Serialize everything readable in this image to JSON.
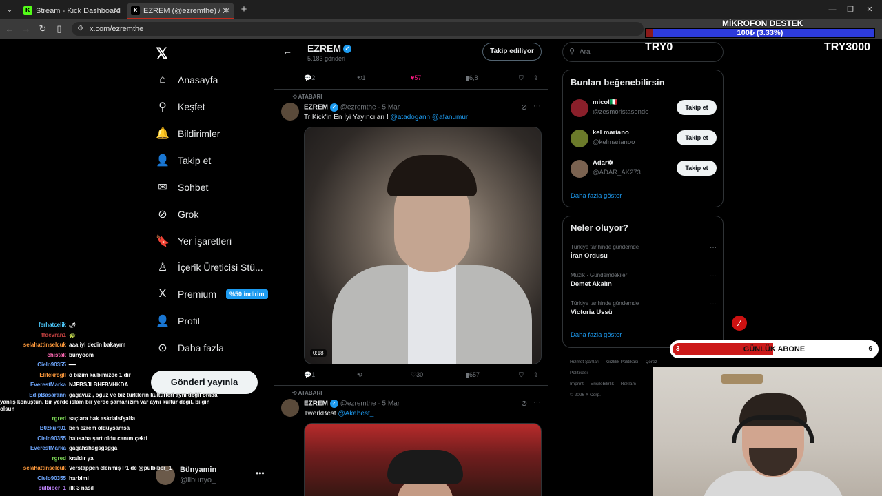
{
  "browser": {
    "tabs": [
      {
        "title": "Stream - Kick Dashboard",
        "favicon": "K"
      },
      {
        "title": "EZREM (@ezremthe) / X",
        "favicon": "X"
      }
    ],
    "url": "x.com/ezremthe"
  },
  "overlay": {
    "mic_title": "MİKROFON DESTEK",
    "mic_bar": "100₺ (3.33%)",
    "mic_progress": 0.0333,
    "try_left": "TRY0",
    "try_right": "TRY3000",
    "abone_label": "GÜNLÜK ABONE",
    "abone_current": "3",
    "abone_target": "6"
  },
  "x_nav": {
    "items": [
      {
        "label": "Anasayfa",
        "icon": "home-icon",
        "glyph": "⌂"
      },
      {
        "label": "Keşfet",
        "icon": "search-icon",
        "glyph": "⚲"
      },
      {
        "label": "Bildirimler",
        "icon": "bell-icon",
        "glyph": "🔔"
      },
      {
        "label": "Takip et",
        "icon": "person-add-icon",
        "glyph": "👤"
      },
      {
        "label": "Sohbet",
        "icon": "mail-icon",
        "glyph": "✉"
      },
      {
        "label": "Grok",
        "icon": "grok-icon",
        "glyph": "⊘"
      },
      {
        "label": "Yer İşaretleri",
        "icon": "bookmark-icon",
        "glyph": "🔖"
      },
      {
        "label": "İçerik Üreticisi Stü...",
        "icon": "creator-icon",
        "glyph": "♙"
      },
      {
        "label": "Premium",
        "icon": "x-premium-icon",
        "glyph": "X"
      },
      {
        "label": "Profil",
        "icon": "profile-icon",
        "glyph": "👤"
      },
      {
        "label": "Daha fazla",
        "icon": "more-circle-icon",
        "glyph": "⊙"
      }
    ],
    "premium_badge": "%50 indirim",
    "post_button": "Gönderi yayınla",
    "account_name": "Bünyamin",
    "account_handle": "@llbunyo_"
  },
  "chat": [
    {
      "user": "ferhatcelik",
      "msg": "🌶",
      "color": "#4ecbff"
    },
    {
      "user": "ffdevran1",
      "msg": "🐢",
      "color": "#c04040"
    },
    {
      "user": "selahattinselcuk",
      "msg": "aaa iyi dedin bakayım",
      "color": "#ff9a3c"
    },
    {
      "user": "chistak",
      "msg": "bunyoom",
      "color": "#ff69b4"
    },
    {
      "user": "Cielo90355",
      "msg": "━━",
      "color": "#6fa8ff"
    },
    {
      "user": "Elifckrogll",
      "msg": "o bizim kalbimizde 1 dir",
      "color": "#ff9a3c"
    },
    {
      "user": "EverestMarka",
      "msg": "NJFBSJLBHFBVHKDA",
      "color": "#6fa8ff"
    },
    {
      "user": "EdipBasarann",
      "msg": "gagavuz , oğuz ve biz türklerin kültürleri aynı değil orada yanlış konuştun. bir yerde islam bir yerde şamanizim var aynı kültür değil. bilgin olsun",
      "color": "#6fa8ff"
    },
    {
      "user": "rgred",
      "msg": "saçlara bak askdalsfşalfa",
      "color": "#7ed957"
    },
    {
      "user": "B0zkurt01",
      "msg": "ben ezrem olduysamsa",
      "color": "#6fa8ff"
    },
    {
      "user": "Cielo90355",
      "msg": "halısaha şart oldu canım çekti",
      "color": "#6fa8ff"
    },
    {
      "user": "EverestMarka",
      "msg": "gagahshsgsgsgga",
      "color": "#6fa8ff"
    },
    {
      "user": "rgred",
      "msg": "kraldır ya",
      "color": "#7ed957"
    },
    {
      "user": "selahattinselcuk",
      "msg": "Verstappen elenmiş P1 de @pulbiber_1",
      "color": "#ff9a3c"
    },
    {
      "user": "Cielo90355",
      "msg": "harbimi",
      "color": "#6fa8ff"
    },
    {
      "user": "pulbiber_1",
      "msg": "ilk 3 nasıl",
      "color": "#c084fc"
    }
  ],
  "profile_header": {
    "name": "EZREM",
    "post_count": "5.183 gönderi",
    "follow_label": "Takip ediliyor"
  },
  "top_actions": {
    "replies": "2",
    "reposts": "1",
    "likes": "57",
    "views": "6,8"
  },
  "posts": [
    {
      "repost_label": "ATABARI",
      "name": "EZREM",
      "handle": "@ezremthe",
      "date": "· 5 Mar",
      "text": "Tr Kick'in En İyi Yayıncıları !",
      "mentions": "@atadogann @afanumur",
      "duration": "0:18",
      "replies": "1",
      "reposts": "",
      "likes": "30",
      "views": "657"
    },
    {
      "repost_label": "ATABARI",
      "name": "EZREM",
      "handle": "@ezremthe",
      "date": "· 5 Mar",
      "text": "TwerkBest",
      "mentions": "@Akabest_"
    }
  ],
  "right": {
    "search_placeholder": "Ara",
    "suggest_title": "Bunları beğenebilirsin",
    "suggestions": [
      {
        "name": "micol🇮🇹",
        "handle": "@zesmoristasende",
        "button": "Takip et"
      },
      {
        "name": "kel mariano",
        "handle": "@kelmarianoo",
        "button": "Takip et"
      },
      {
        "name": "Adar☸",
        "handle": "@ADAR_AK273",
        "button": "Takip et"
      }
    ],
    "show_more": "Daha fazla göster",
    "trends_title": "Neler oluyor?",
    "trends": [
      {
        "context": "Türkiye tarihinde gündemde",
        "title": "İran Ordusu"
      },
      {
        "context": "Müzik · Gündemdekiler",
        "title": "Demet Akalın"
      },
      {
        "context": "Türkiye tarihinde gündemde",
        "title": "Victoria Üssü"
      }
    ],
    "show_more2": "Daha fazla göster",
    "footer": [
      "Hizmet Şartları",
      "Gizlilik Politikası",
      "Çerez Politikası",
      "Imprint",
      "Erişilebilirlik",
      "Reklam",
      "© 2026 X Corp."
    ]
  },
  "colors": {
    "accent": "#1d9bf0",
    "like": "#f91880",
    "kick": "#53fc18",
    "overlay_red": "#cc1a1a"
  }
}
